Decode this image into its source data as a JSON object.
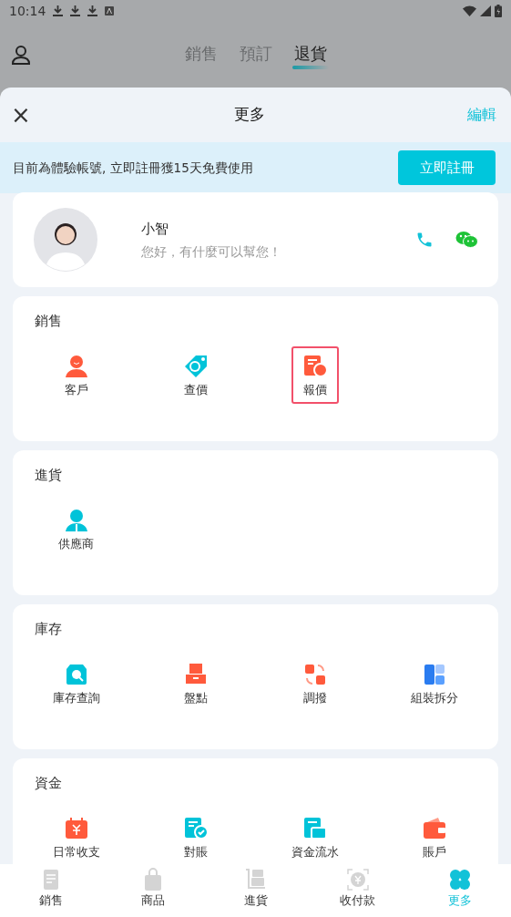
{
  "status_bar": {
    "time": "10:14"
  },
  "top_tabs": [
    {
      "label": "銷售",
      "selected": false
    },
    {
      "label": "預訂",
      "selected": false
    },
    {
      "label": "退貨",
      "selected": true
    }
  ],
  "sheet": {
    "title": "更多",
    "close": "×",
    "edit": "編輯"
  },
  "banner": {
    "text": "目前為體驗帳號, 立即註冊獲15天免費使用",
    "button": "立即註冊"
  },
  "assistant": {
    "name": "小智",
    "greeting": "您好，有什麼可以幫您！"
  },
  "sections": [
    {
      "title": "銷售",
      "items": [
        {
          "label": "客戶",
          "highlighted": false
        },
        {
          "label": "查價",
          "highlighted": false
        },
        {
          "label": "報價",
          "highlighted": true
        }
      ]
    },
    {
      "title": "進貨",
      "items": [
        {
          "label": "供應商",
          "highlighted": false
        }
      ]
    },
    {
      "title": "庫存",
      "items": [
        {
          "label": "庫存查詢",
          "highlighted": false
        },
        {
          "label": "盤點",
          "highlighted": false
        },
        {
          "label": "調撥",
          "highlighted": false
        },
        {
          "label": "組裝拆分",
          "highlighted": false
        }
      ]
    },
    {
      "title": "資金",
      "items": [
        {
          "label": "日常收支",
          "highlighted": false
        },
        {
          "label": "對賬",
          "highlighted": false
        },
        {
          "label": "資金流水",
          "highlighted": false
        },
        {
          "label": "賬戶",
          "highlighted": false
        }
      ]
    }
  ],
  "bottom_nav": [
    {
      "label": "銷售",
      "selected": false
    },
    {
      "label": "商品",
      "selected": false
    },
    {
      "label": "進貨",
      "selected": false
    },
    {
      "label": "收付款",
      "selected": false
    },
    {
      "label": "更多",
      "selected": true
    }
  ]
}
